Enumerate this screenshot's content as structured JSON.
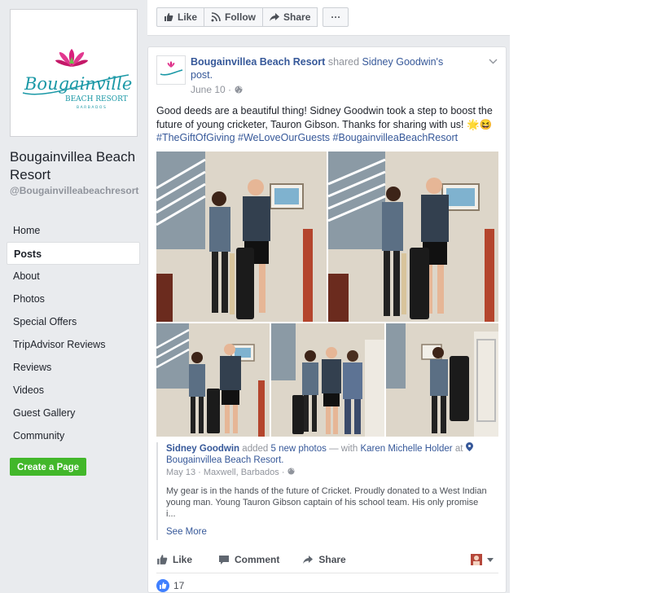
{
  "page": {
    "name": "Bougainvillea Beach Resort",
    "handle": "@Bougainvilleabeachresort",
    "logo": {
      "word": "Bougainvillea",
      "sub": "BEACH RESORT",
      "country": "BARBADOS"
    }
  },
  "sidebar": {
    "items": [
      {
        "label": "Home"
      },
      {
        "label": "Posts"
      },
      {
        "label": "About"
      },
      {
        "label": "Photos"
      },
      {
        "label": "Special Offers"
      },
      {
        "label": "TripAdvisor Reviews"
      },
      {
        "label": "Reviews"
      },
      {
        "label": "Videos"
      },
      {
        "label": "Guest Gallery"
      },
      {
        "label": "Community"
      }
    ],
    "create_page": "Create a Page"
  },
  "top_actions": {
    "like": "Like",
    "follow": "Follow",
    "share": "Share",
    "more": "···"
  },
  "post": {
    "author": "Bougainvillea Beach Resort",
    "shared_word": "shared",
    "shared_from": "Sidney Goodwin's",
    "post_word": "post.",
    "date": "June 10 ·",
    "text": "Good deeds are a beautiful thing! Sidney Goodwin took a step to boost the future of young cricketer, Tauron Gibson. Thanks for sharing with us! 🌟😆",
    "hashtags": "#TheGiftOfGiving #WeLoveOurGuests #BougainvilleaBeachResort",
    "shared": {
      "author": "Sidney Goodwin",
      "added": "added",
      "photos_link": "5 new photos",
      "with": "— with",
      "with_name": "Karen Michelle Holder",
      "at": "at",
      "location": "Bougainvillea Beach Resort.",
      "meta": "May 13 · Maxwell, Barbados ·",
      "body": "My gear is in the hands of the future of Cricket. Proudly donated to a West Indian young man. Young Tauron Gibson captain of his school team. His only promise i...",
      "see_more": "See More"
    },
    "actions": {
      "like": "Like",
      "comment": "Comment",
      "share": "Share"
    },
    "reaction_count": "17"
  },
  "colors": {
    "link_blue": "#365899",
    "fb_gray": "#e9ebee",
    "green_button": "#42b72a",
    "like_blue": "#4080ff"
  }
}
